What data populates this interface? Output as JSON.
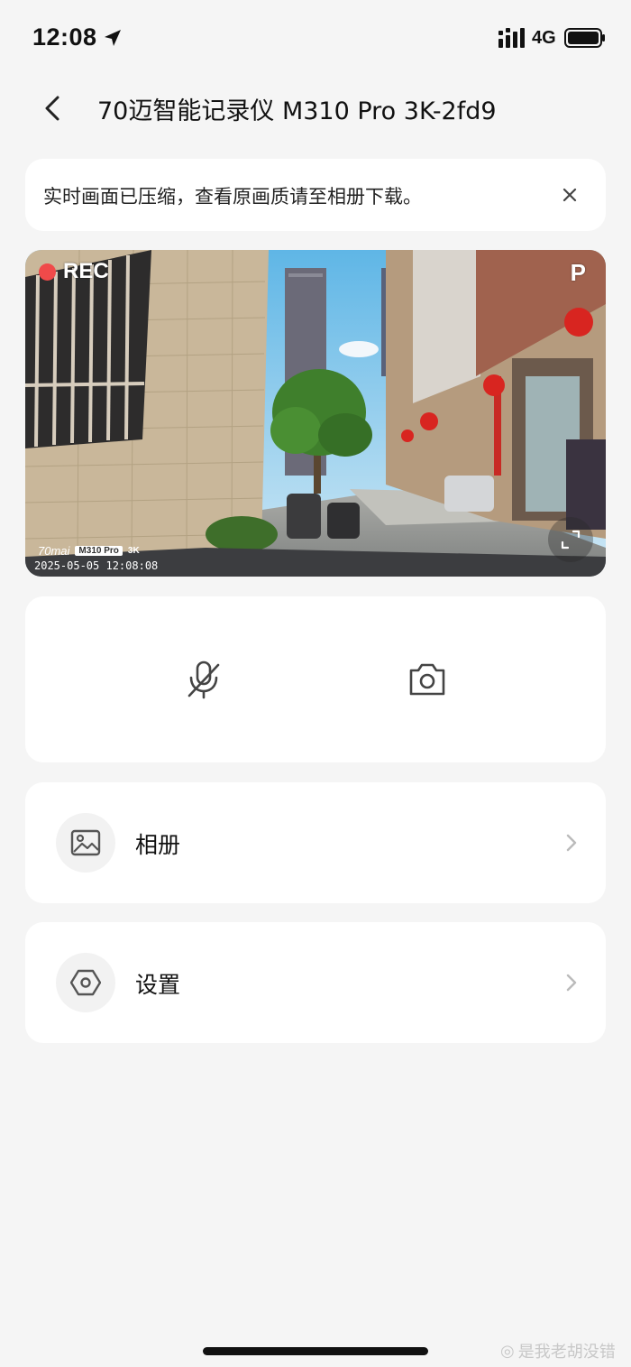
{
  "status_bar": {
    "time": "12:08",
    "network": "4G"
  },
  "nav": {
    "title": "70迈智能记录仪 M310 Pro 3K-2fd9"
  },
  "notice": {
    "text": "实时画面已压缩，查看原画质请至相册下载。"
  },
  "video": {
    "rec_label": "REC",
    "mode_label": "P",
    "watermark_brand": "70mai",
    "watermark_model": "M310 Pro",
    "watermark_resolution": "3K",
    "watermark_timestamp": "2025-05-05 12:08:08"
  },
  "menu": {
    "album_label": "相册",
    "settings_label": "设置"
  },
  "overlay_watermark": "是我老胡没错",
  "colors": {
    "background": "#f5f5f5",
    "card": "#ffffff",
    "rec_red": "#f04a4a",
    "icon_gray": "#444444"
  },
  "icons": {
    "back": "chevron-left-icon",
    "close": "close-icon",
    "mute": "microphone-off-icon",
    "snapshot": "camera-icon",
    "album": "image-icon",
    "settings": "hexagon-gear-icon",
    "fullscreen": "fullscreen-icon"
  }
}
